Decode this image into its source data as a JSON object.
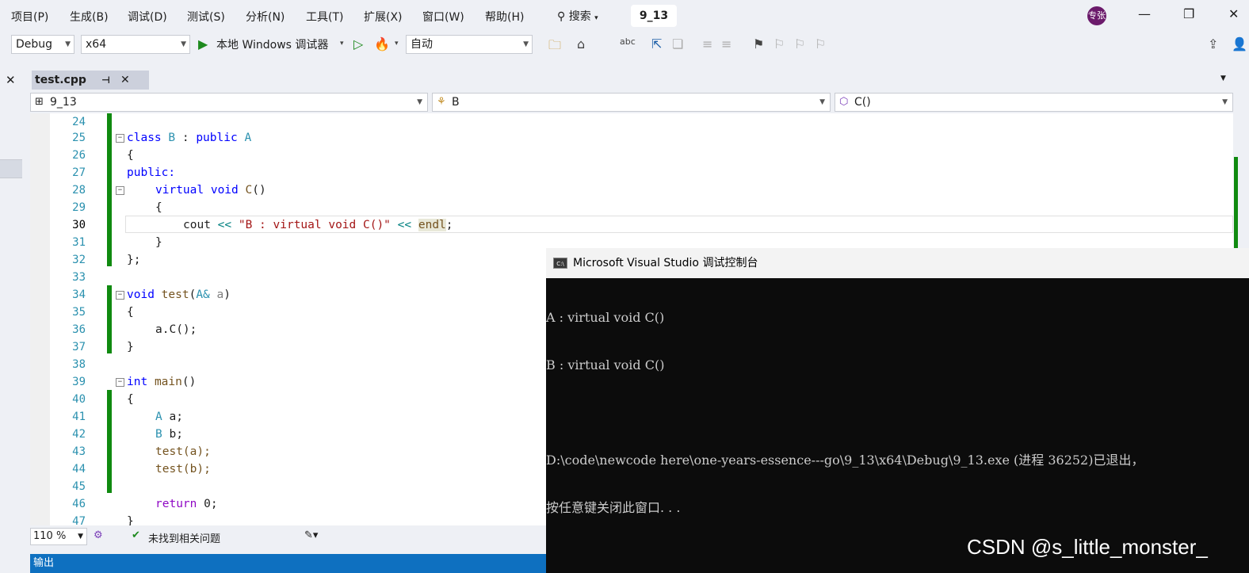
{
  "menu": {
    "items": [
      "项目(P)",
      "生成(B)",
      "调试(D)",
      "测试(S)",
      "分析(N)",
      "工具(T)",
      "扩展(X)",
      "窗口(W)",
      "帮助(H)"
    ],
    "search_label": "搜索",
    "solution_name": "9_13",
    "user_initials": "专张"
  },
  "toolbar": {
    "config": "Debug",
    "platform": "x64",
    "debugger_label": "本地 Windows 调试器",
    "auto_label": "自动"
  },
  "tab": {
    "label": "test.cpp"
  },
  "nav": {
    "project": "9_13",
    "class": "B",
    "member": "C()"
  },
  "editor": {
    "current_line": "30",
    "lines": [
      {
        "n": "24"
      },
      {
        "n": "25"
      },
      {
        "n": "26"
      },
      {
        "n": "27"
      },
      {
        "n": "28"
      },
      {
        "n": "29"
      },
      {
        "n": "30"
      },
      {
        "n": "31"
      },
      {
        "n": "32"
      },
      {
        "n": "33"
      },
      {
        "n": "34"
      },
      {
        "n": "35"
      },
      {
        "n": "36"
      },
      {
        "n": "37"
      },
      {
        "n": "38"
      },
      {
        "n": "39"
      },
      {
        "n": "40"
      },
      {
        "n": "41"
      },
      {
        "n": "42"
      },
      {
        "n": "43"
      },
      {
        "n": "44"
      },
      {
        "n": "45"
      },
      {
        "n": "46"
      },
      {
        "n": "47"
      }
    ],
    "tokens": {
      "class": "class",
      "B": "B",
      "colon_public": " : ",
      "public": "public",
      "A": "A",
      "brace_open": "{",
      "brace_close": "}",
      "brace_semicolon": "};",
      "public_label": "public:",
      "virtual": "virtual",
      "void": "void",
      "C": "C",
      "paren": "()",
      "cout": "cout",
      "shl": "<<",
      "str": "\"B : virtual void C()\"",
      "endl": "endl",
      "semi": ";",
      "test": "test",
      "A_amp": "A&",
      "a": "a",
      "a_call": "a.C();",
      "int": "int",
      "main": "main",
      "A_decl": "A",
      "a_decl": " a;",
      "B_decl": "B",
      "b_decl": " b;",
      "test_a": "test(a);",
      "test_b": "test(b);",
      "return": "return",
      "zero": " 0;"
    }
  },
  "status": {
    "zoom": "110 %",
    "issues": "未找到相关问题"
  },
  "output": {
    "label": "输出"
  },
  "console": {
    "title": "Microsoft Visual Studio 调试控制台",
    "lines": [
      "A : virtual void C()",
      "B : virtual void C()",
      "",
      "D:\\code\\newcode here\\one-years-essence---go\\9_13\\x64\\Debug\\9_13.exe (进程 36252)已退出，",
      "按任意键关闭此窗口. . ."
    ]
  },
  "watermark": "CSDN @s_little_monster_",
  "colors": {
    "green_bar": "#108a10",
    "accent_blue": "#0e70c0",
    "console_bg": "#0c0c0c"
  }
}
